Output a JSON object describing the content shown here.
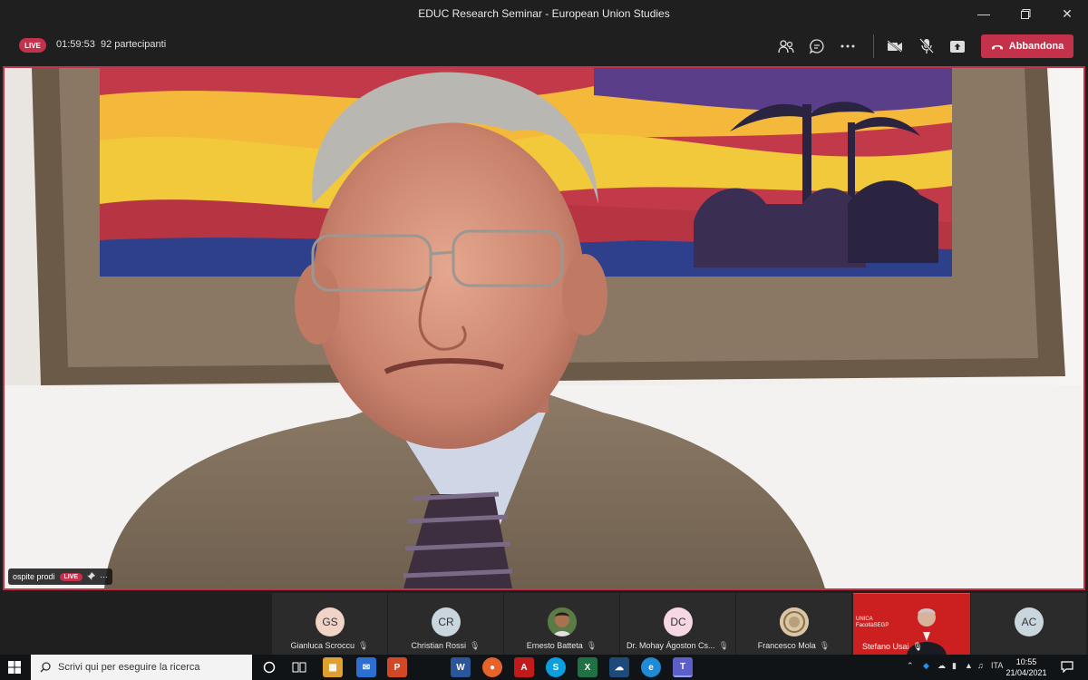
{
  "window": {
    "title": "EDUC Research Seminar - European Union Studies",
    "controls": [
      "minimize-icon",
      "maximize-icon",
      "close-icon"
    ]
  },
  "toolbar": {
    "live_label": "LIVE",
    "elapsed": "01:59:53",
    "participants": "92 partecipanti",
    "icons": [
      "participants-icon",
      "chat-icon",
      "more-icon",
      "camera-off-icon",
      "mic-off-icon",
      "share-icon"
    ],
    "leave_label": "Abbandona",
    "leave_color": "#c4314b"
  },
  "main_video": {
    "speaker_name": "ospite prodi",
    "live_label": "LIVE",
    "more_label": "···"
  },
  "participants": [
    {
      "initials": "GS",
      "name": "Gianluca Scroccu",
      "avatar_color": "#f2d3c8"
    },
    {
      "initials": "CR",
      "name": "Christian Rossi",
      "avatar_color": "#c9d6de"
    },
    {
      "initials": "",
      "name": "Ernesto Batteta",
      "avatar_color": "#8b5a3c"
    },
    {
      "initials": "DC",
      "name": "Dr. Mohay Ágoston Cs...",
      "avatar_color": "#f6d7e3"
    },
    {
      "initials": "",
      "name": "Francesco Mola",
      "avatar_color": "#d8c6a4"
    },
    {
      "initials": "",
      "name": "Stefano Usai",
      "avatar_color": "#cc1f1f",
      "logo_text": "UNICA",
      "logo_sub": "FacoltàSEGP"
    },
    {
      "initials": "AC",
      "name": "",
      "avatar_color": "#c9d6de"
    }
  ],
  "taskbar": {
    "search_placeholder": "Scrivi qui per eseguire la ricerca",
    "language": "ITA",
    "time": "10:55",
    "date": "21/04/2021"
  }
}
